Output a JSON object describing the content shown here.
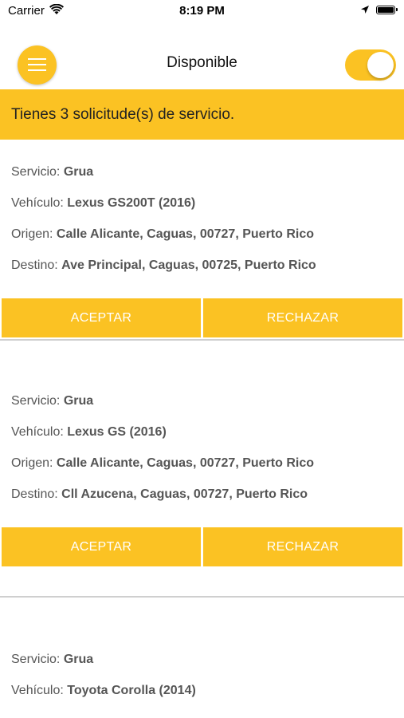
{
  "status_bar": {
    "carrier": "Carrier",
    "time": "8:19 PM"
  },
  "nav": {
    "title": "Disponible"
  },
  "toggle": {
    "on": true
  },
  "banner": {
    "text": "Tienes 3 solicitude(s) de servicio."
  },
  "labels": {
    "servicio": "Servicio:",
    "vehiculo": "Vehículo:",
    "origen": "Origen:",
    "destino": "Destino:",
    "accept": "ACEPTAR",
    "reject": "RECHAZAR"
  },
  "requests": [
    {
      "servicio": "Grua",
      "vehiculo": "Lexus GS200T (2016)",
      "origen": "Calle Alicante, Caguas, 00727, Puerto Rico",
      "destino": "Ave Principal, Caguas, 00725, Puerto Rico"
    },
    {
      "servicio": "Grua",
      "vehiculo": "Lexus GS (2016)",
      "origen": "Calle Alicante, Caguas, 00727, Puerto Rico",
      "destino": "Cll Azucena, Caguas, 00727, Puerto Rico"
    },
    {
      "servicio": "Grua",
      "vehiculo": "Toyota Corolla (2014)"
    }
  ],
  "colors": {
    "accent": "#fbc223",
    "text": "#555555",
    "divider": "#cfcfcf"
  }
}
